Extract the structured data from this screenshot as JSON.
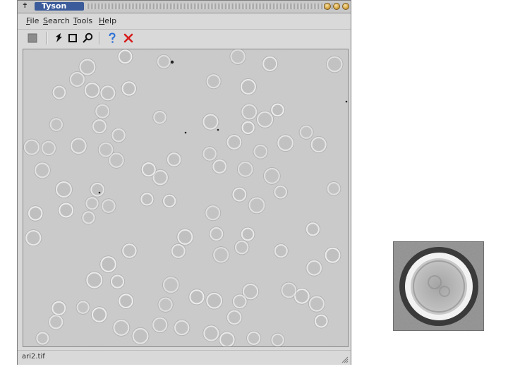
{
  "window": {
    "title": "Tyson",
    "system_icon": "pin-icon",
    "controls": [
      "minimize-icon",
      "maximize-icon",
      "close-icon"
    ]
  },
  "menu": {
    "items": [
      {
        "label": "File"
      },
      {
        "label": "Search"
      },
      {
        "label": "Tools"
      },
      {
        "label": "Help"
      }
    ]
  },
  "toolbar": {
    "buttons": [
      {
        "icon": "print-icon"
      },
      {
        "icon": "pointer-icon"
      },
      {
        "icon": "select-box-icon"
      },
      {
        "icon": "search-icon"
      },
      {
        "icon": "help-icon"
      },
      {
        "icon": "close-icon"
      }
    ]
  },
  "status": {
    "filename": "ari2.tif"
  },
  "colors": {
    "canvas_background": "#c9c9c9",
    "particle_ring": "#f2f2f2",
    "help_icon": "#2a6fd6",
    "close_icon": "#d61f1f"
  }
}
